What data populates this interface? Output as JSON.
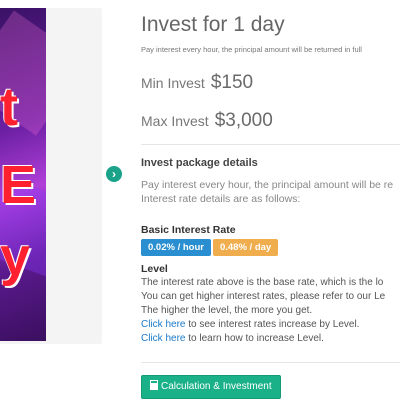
{
  "banner": {
    "letters": [
      "t",
      "E",
      "y"
    ]
  },
  "plan": {
    "title": "Invest for 1 day",
    "subtitle": "Pay interest every hour, the principal amount will be returned in full",
    "min_label": "Min Invest",
    "min_value": "$150",
    "max_label": "Max Invest",
    "max_value": "$3,000"
  },
  "details": {
    "title": "Invest package details",
    "line1": "Pay interest every hour, the principal amount will be re",
    "line2": "Interest rate details are as follows:"
  },
  "rates": {
    "title": "Basic Interest Rate",
    "hourly": "0.02% / hour",
    "daily": "0.48% / day"
  },
  "level": {
    "title": "Level",
    "line1": "The interest rate above is the base rate, which is the lo",
    "line2": "You can get higher interest rates, please refer to our Le",
    "line3": "The higher the level, the more you get.",
    "link1": "Click here",
    "link1_text": " to see interest rates increase by Level.",
    "link2": "Click here",
    "link2_text": " to learn how to increase Level."
  },
  "actions": {
    "calc_label": "Calculation & Investment"
  },
  "colors": {
    "accent_green": "#1ab188",
    "badge_blue": "#2a8fd0",
    "badge_orange": "#f0ad4e",
    "link_blue": "#1a7ac8"
  },
  "icons": {
    "next": "chevron-right-icon",
    "calculator": "calculator-icon"
  }
}
